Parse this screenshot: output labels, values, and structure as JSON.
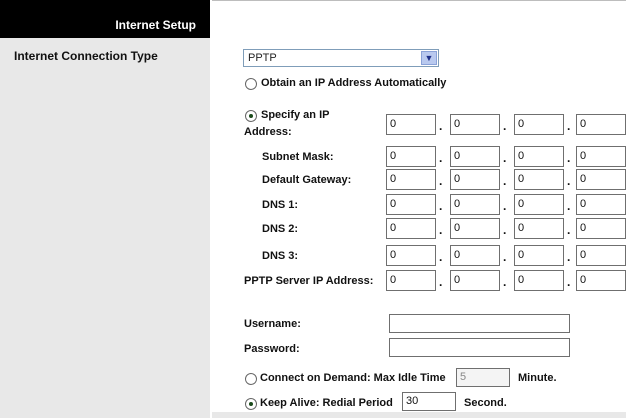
{
  "sidebar": {
    "header_title": "Internet Setup",
    "section_label": "Internet Connection Type"
  },
  "connection_type": {
    "selected": "PPTP"
  },
  "obtain_auto": {
    "label": "Obtain an IP Address Automatically",
    "selected": false
  },
  "specify_ip": {
    "label_line1": "Specify an IP",
    "label_line2": "Address:",
    "selected": true
  },
  "ip_rows": [
    {
      "label": "",
      "octets": [
        "0",
        "0",
        "0",
        "0"
      ]
    },
    {
      "label": "Subnet Mask:",
      "octets": [
        "0",
        "0",
        "0",
        "0"
      ]
    },
    {
      "label": "Default Gateway:",
      "octets": [
        "0",
        "0",
        "0",
        "0"
      ]
    },
    {
      "label": "DNS 1:",
      "octets": [
        "0",
        "0",
        "0",
        "0"
      ]
    },
    {
      "label": "DNS 2:",
      "octets": [
        "0",
        "0",
        "0",
        "0"
      ]
    },
    {
      "label": "DNS 3:",
      "octets": [
        "0",
        "0",
        "0",
        "0"
      ]
    },
    {
      "label": "PPTP Server IP Address:",
      "octets": [
        "0",
        "0",
        "0",
        "0"
      ]
    }
  ],
  "username": {
    "label": "Username:",
    "value": ""
  },
  "password": {
    "label": "Password:",
    "value": ""
  },
  "connect_on_demand": {
    "label": "Connect on Demand: Max Idle Time",
    "value": "5",
    "unit": "Minute.",
    "selected": false
  },
  "keep_alive": {
    "label": "Keep Alive: Redial Period",
    "value": "30",
    "unit": "Second.",
    "selected": true
  }
}
